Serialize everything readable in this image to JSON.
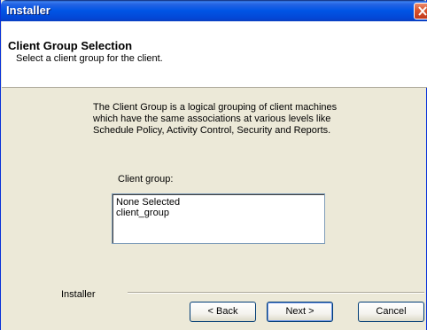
{
  "window": {
    "title": "Installer"
  },
  "header": {
    "title": "Client Group Selection",
    "subtitle": "Select a client group for the client."
  },
  "description": {
    "lines": [
      "The Client Group is a logical grouping of client machines",
      "which have the same associations at various levels like",
      "Schedule Policy, Activity Control, Security and Reports."
    ]
  },
  "client_group": {
    "label": "Client group:",
    "options": [
      "None Selected",
      "client_group"
    ]
  },
  "footer": {
    "separator_label": "Installer",
    "back_label": "< Back",
    "next_label": "Next >",
    "cancel_label": "Cancel"
  },
  "colors": {
    "title_bar": "#0055e5",
    "close_button": "#d9532c",
    "dialog_background": "#ece9d8",
    "header_background": "#ffffff"
  },
  "icons": [
    "close-icon"
  ]
}
